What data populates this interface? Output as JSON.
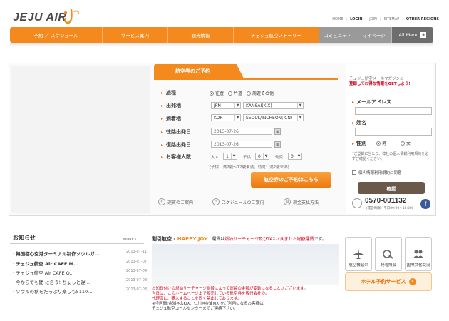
{
  "brand": {
    "name": "JEJU AIR"
  },
  "toplinks": [
    "HOME",
    "LOGIN",
    "JOIN",
    "SITEMAP",
    "OTHER REGIONS"
  ],
  "nav": {
    "items": [
      "予約 ／ スケジュール",
      "サービス案内",
      "観光情報",
      "チェジュ航空ストーリー",
      "コミュニティ",
      "マイページ"
    ],
    "all_menu": "All Menu"
  },
  "booking": {
    "tab": "航空券のご予約",
    "trip_label": "旅程",
    "trip_options": [
      "往復",
      "片道",
      "周遊その他"
    ],
    "from_label": "出発地",
    "from_country": "JPN",
    "from_city": "KANSAI(KIX)",
    "to_label": "到着地",
    "to_country": "KOR",
    "to_city": "SEOUL/INCHEON(ICN)",
    "depart_label": "往路出発日",
    "depart_date": "2013-07-26",
    "return_label": "復路出発日",
    "return_date": "2013-07-26",
    "pax_label": "お客様人数",
    "adult_label": "大人",
    "adult_count": "1",
    "child_label": "子供",
    "child_count": "0",
    "infant_label": "幼児",
    "infant_count": "0",
    "pax_note": "(子供：満2歳〜12歳未満，幼児：満2歳未満)",
    "submit": "航空券のご予約はこちら",
    "links": [
      "運賃のご案内",
      "スケジュールのご案内",
      "現金支払方法"
    ]
  },
  "newsletter": {
    "title_small": "チェジュ航空メールマガジンに",
    "title_main": "登録してお得な情報をGETしよう!",
    "email_label": "メールアドレス",
    "name_label": "姓名",
    "gender_label": "性別",
    "gender_options": [
      "男",
      "女"
    ],
    "note": "*ご登録に当たり、弊社の個人情報利用規約を必ずご確認ください。",
    "consent": "個人情報利用規約に同意",
    "submit": "確認",
    "phone": "0570-001132",
    "phone_hours": "(運営時間：平日09:00〜18:00)"
  },
  "news": {
    "title": "お知らせ",
    "more": "MORE ›",
    "items": [
      {
        "title": "韓国都心空港ターミナル制作ソウルガ...",
        "date": "[2013-07-11]"
      },
      {
        "title": "チェジュ航空 Air CAFE M...",
        "date": "[2013-07-07]"
      },
      {
        "title": "チェジュ航空 Air CAFE O...",
        "date": "[2013-07-04]"
      },
      {
        "title": "今からでも間 に合う! ちょっと遅...",
        "date": "[2013-07-03]"
      },
      {
        "title": "ソウルの秋をたっぷり楽しも5110...",
        "date": "[2013-07-03]"
      }
    ]
  },
  "sale": {
    "title": "割引航空",
    "happy": "HAPPY JOY",
    "desc_a": "：運賃は",
    "desc_red": "燃油サーチャージ及びTAXが含まれた総額運賃",
    "desc_b": "です。",
    "notes_red": [
      "お知日付けの燃油サーチャージ為替によって運賃の金額が変動になることがございます。",
      "当日は、このホームページ上で販売している航空券を販行会社の。",
      "代理店に、購入することを固く禁止しております。"
    ],
    "notes_black": [
      "※今区間(金浦⇔広KIX、仁川⇔金浦MX)をご利用になるお客様は",
      "チェジュ航空コールセンターまでご連絡下さい。"
    ]
  },
  "quick": {
    "items": [
      "航空機紹介",
      "発着照会",
      "国際文化交流"
    ],
    "hotel": "ホテル予約サービス"
  }
}
